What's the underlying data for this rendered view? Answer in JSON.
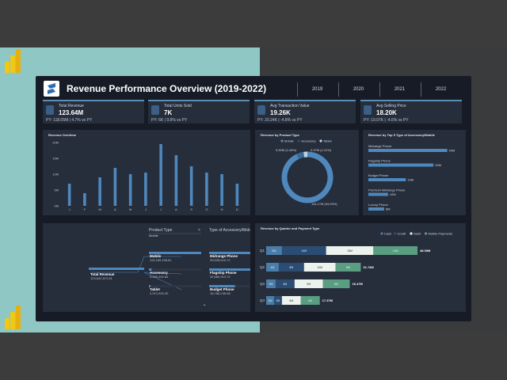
{
  "header": {
    "title": "Revenue Performance Overview (2019-2022)",
    "years": [
      "2019",
      "2020",
      "2021",
      "2022"
    ]
  },
  "kpis": [
    {
      "label": "Total Revenue",
      "value": "123.64M",
      "sub": "PY: 118.05M | 4.7% vs PY",
      "icon": "dollar-icon"
    },
    {
      "label": "Total Units Sold",
      "value": "7K",
      "sub": "PY: 6K | 9.8% vs PY",
      "icon": "cube-icon"
    },
    {
      "label": "Avg Transaction Value",
      "value": "19.26K",
      "sub": "PY: 20.24K | -4.8% vs PY",
      "icon": "cart-icon"
    },
    {
      "label": "Avg Selling Price",
      "value": "18.20K",
      "sub": "PY: 19.07K | -4.6% vs PY",
      "icon": "tag-icon"
    }
  ],
  "overtime": {
    "title": "Revenue Overtime",
    "chart_data": {
      "type": "bar",
      "categories": [
        "J",
        "F",
        "M",
        "A",
        "M",
        "J",
        "J",
        "A",
        "S",
        "O",
        "N",
        "D"
      ],
      "values": [
        7,
        4,
        9,
        12,
        10,
        10.5,
        19.5,
        16,
        12.5,
        10.5,
        10,
        7
      ],
      "yticks": [
        "20M",
        "15M",
        "10M",
        "5M",
        "0M"
      ],
      "ylim": [
        0,
        20
      ]
    }
  },
  "producttype": {
    "title": "Revenue by Product Type",
    "legend": [
      "Mobile",
      "Accessory",
      "Tablet"
    ],
    "chart_data": {
      "type": "pie",
      "labels": [
        "Mobile",
        "Accessory",
        "Tablet"
      ],
      "values": [
        115.17,
        5.5,
        2.97
      ],
      "data_labels": [
        "115.17M (94.09%)",
        "5.50M (4.45%)",
        "2.97M (2.41%)"
      ]
    }
  },
  "top5": {
    "title": "Revenue by Top 5 Type of Accessory/Mobile",
    "chart_data": {
      "type": "bar",
      "categories": [
        "Midrange Phone",
        "Flagship Phone",
        "Budget Phone",
        "Premium Midrange Phone",
        "Luxury Phone"
      ],
      "values": [
        40,
        33,
        19,
        10,
        8
      ],
      "data_labels": [
        "40M",
        "33M",
        "19M",
        "10M",
        "8M"
      ],
      "xlim": [
        0,
        45
      ]
    }
  },
  "tree": {
    "root_label": "Total Revenue",
    "root_value": "123,642,572.61",
    "col1_header": "Product Type",
    "col1_filter": "Mobile",
    "col2_header": "Type of Accessory/Mobile",
    "col1": [
      {
        "name": "Mobile",
        "value": "115,169,158.61",
        "fill": 1
      },
      {
        "name": "Accessory",
        "value": "5,490,492.84",
        "fill": 0.05
      },
      {
        "name": "Tablet",
        "value": "2,972,920.20",
        "fill": 0.03
      }
    ],
    "col2": [
      {
        "name": "Midrange Phone",
        "value": "39,528,615.72",
        "fill": 1
      },
      {
        "name": "Flagship Phone",
        "value": "32,680,913.72",
        "fill": 0.83
      },
      {
        "name": "Budget Phone",
        "value": "18,785,235.08",
        "fill": 0.48
      }
    ],
    "close_symbol": "×",
    "more_symbol": "⌄"
  },
  "quarter": {
    "title": "Revenue by Quarter and Payment Type",
    "legend": [
      "Cash",
      "Credit",
      "Debit",
      "Mobile Payments"
    ],
    "colors": [
      "#4a7ea8",
      "#2b4d74",
      "#ecf2ee",
      "#5a9e82"
    ],
    "chart_data": {
      "type": "bar",
      "categories": [
        "Q1",
        "Q2",
        "Q3",
        "Q4"
      ],
      "series": [
        {
          "name": "Cash",
          "values": [
            5,
            4,
            3,
            2.5
          ]
        },
        {
          "name": "Credit",
          "values": [
            14,
            8,
            6,
            2.5
          ]
        },
        {
          "name": "Debit",
          "values": [
            15,
            10,
            9,
            6
          ]
        },
        {
          "name": "Mobile Payments",
          "values": [
            14,
            8,
            8.5,
            6
          ]
        }
      ],
      "data_labels": [
        [
          "5M",
          "14M",
          "15M",
          "14M"
        ],
        [
          "4M",
          "8M",
          "10M",
          "8M"
        ],
        [
          "3M",
          "6M",
          "9M",
          "8M"
        ],
        [
          "3M",
          "3M",
          "6M",
          "6M"
        ]
      ],
      "totals": [
        "48.00M",
        "31.74M",
        "26.47M",
        "17.37M"
      ]
    }
  }
}
